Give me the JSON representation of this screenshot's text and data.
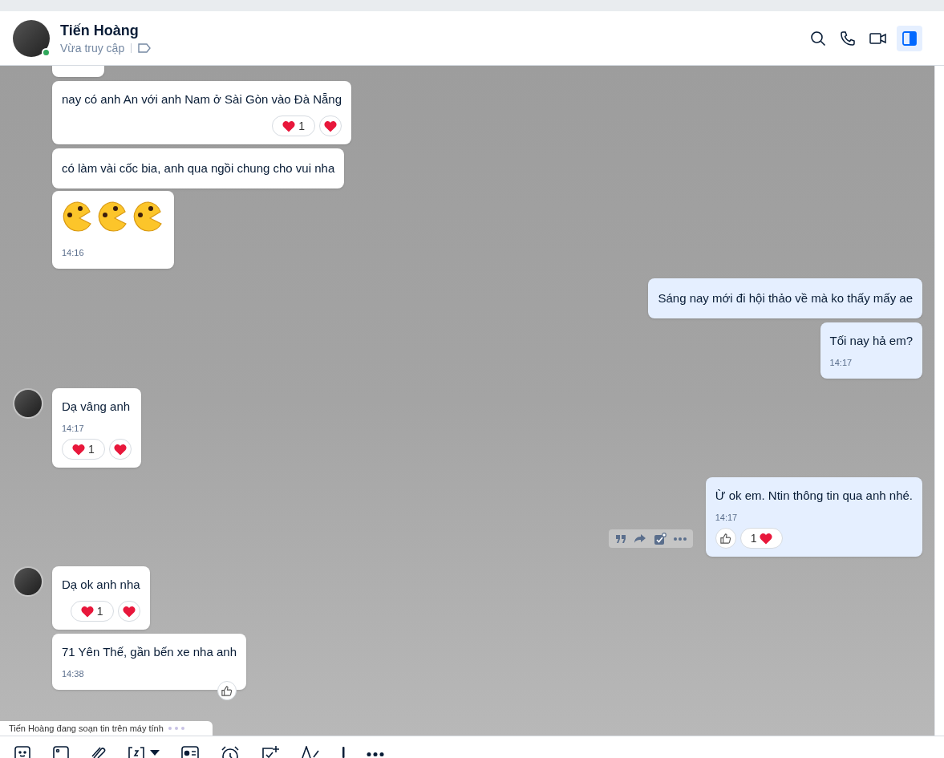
{
  "header": {
    "name": "Tiến Hoàng",
    "status": "Vừa truy cập",
    "online": true,
    "panel_open": true
  },
  "messages": [
    {
      "kind": "clipped",
      "outgoing": false,
      "avatar": false
    },
    {
      "kind": "text",
      "outgoing": false,
      "avatar": false,
      "text": "nay có anh An với anh Nam ở Sài Gòn vào Đà Nẵng",
      "reactions": [
        {
          "kind": "heart_count",
          "count": "1"
        },
        {
          "kind": "heart"
        }
      ]
    },
    {
      "kind": "text",
      "outgoing": false,
      "avatar": false,
      "text": "có làm vài cốc bia, anh qua ngồi chung cho vui nha"
    },
    {
      "kind": "sticker",
      "outgoing": false,
      "avatar": false,
      "time": "14:16"
    },
    {
      "kind": "text",
      "outgoing": true,
      "avatar": false,
      "text": "Sáng nay mới đi hội thảo về mà ko thấy mấy ae"
    },
    {
      "kind": "text",
      "outgoing": true,
      "avatar": false,
      "text": "Tối nay hả em?",
      "time": "14:17"
    },
    {
      "kind": "text",
      "outgoing": false,
      "avatar": true,
      "text": "Dạ vâng anh",
      "time": "14:17",
      "reactions": [
        {
          "kind": "heart_count",
          "count": "1"
        },
        {
          "kind": "heart"
        }
      ]
    },
    {
      "kind": "text",
      "outgoing": true,
      "avatar": false,
      "text": "Ừ ok em. Ntin thông tin qua anh nhé.",
      "time": "14:17",
      "hover_actions": true,
      "reactions": [
        {
          "kind": "like"
        },
        {
          "kind": "count_heart",
          "count": "1"
        }
      ]
    },
    {
      "kind": "text",
      "outgoing": false,
      "avatar": true,
      "text": "Dạ ok anh nha",
      "reactions": [
        {
          "kind": "heart_count",
          "count": "1"
        },
        {
          "kind": "heart"
        }
      ]
    },
    {
      "kind": "text",
      "outgoing": false,
      "avatar": false,
      "text": "71 Yên Thế, gần bến xe nha anh",
      "time": "14:38",
      "like_badge": true
    }
  ],
  "typing": "Tiến Hoàng đang soạn tin trên máy tính"
}
